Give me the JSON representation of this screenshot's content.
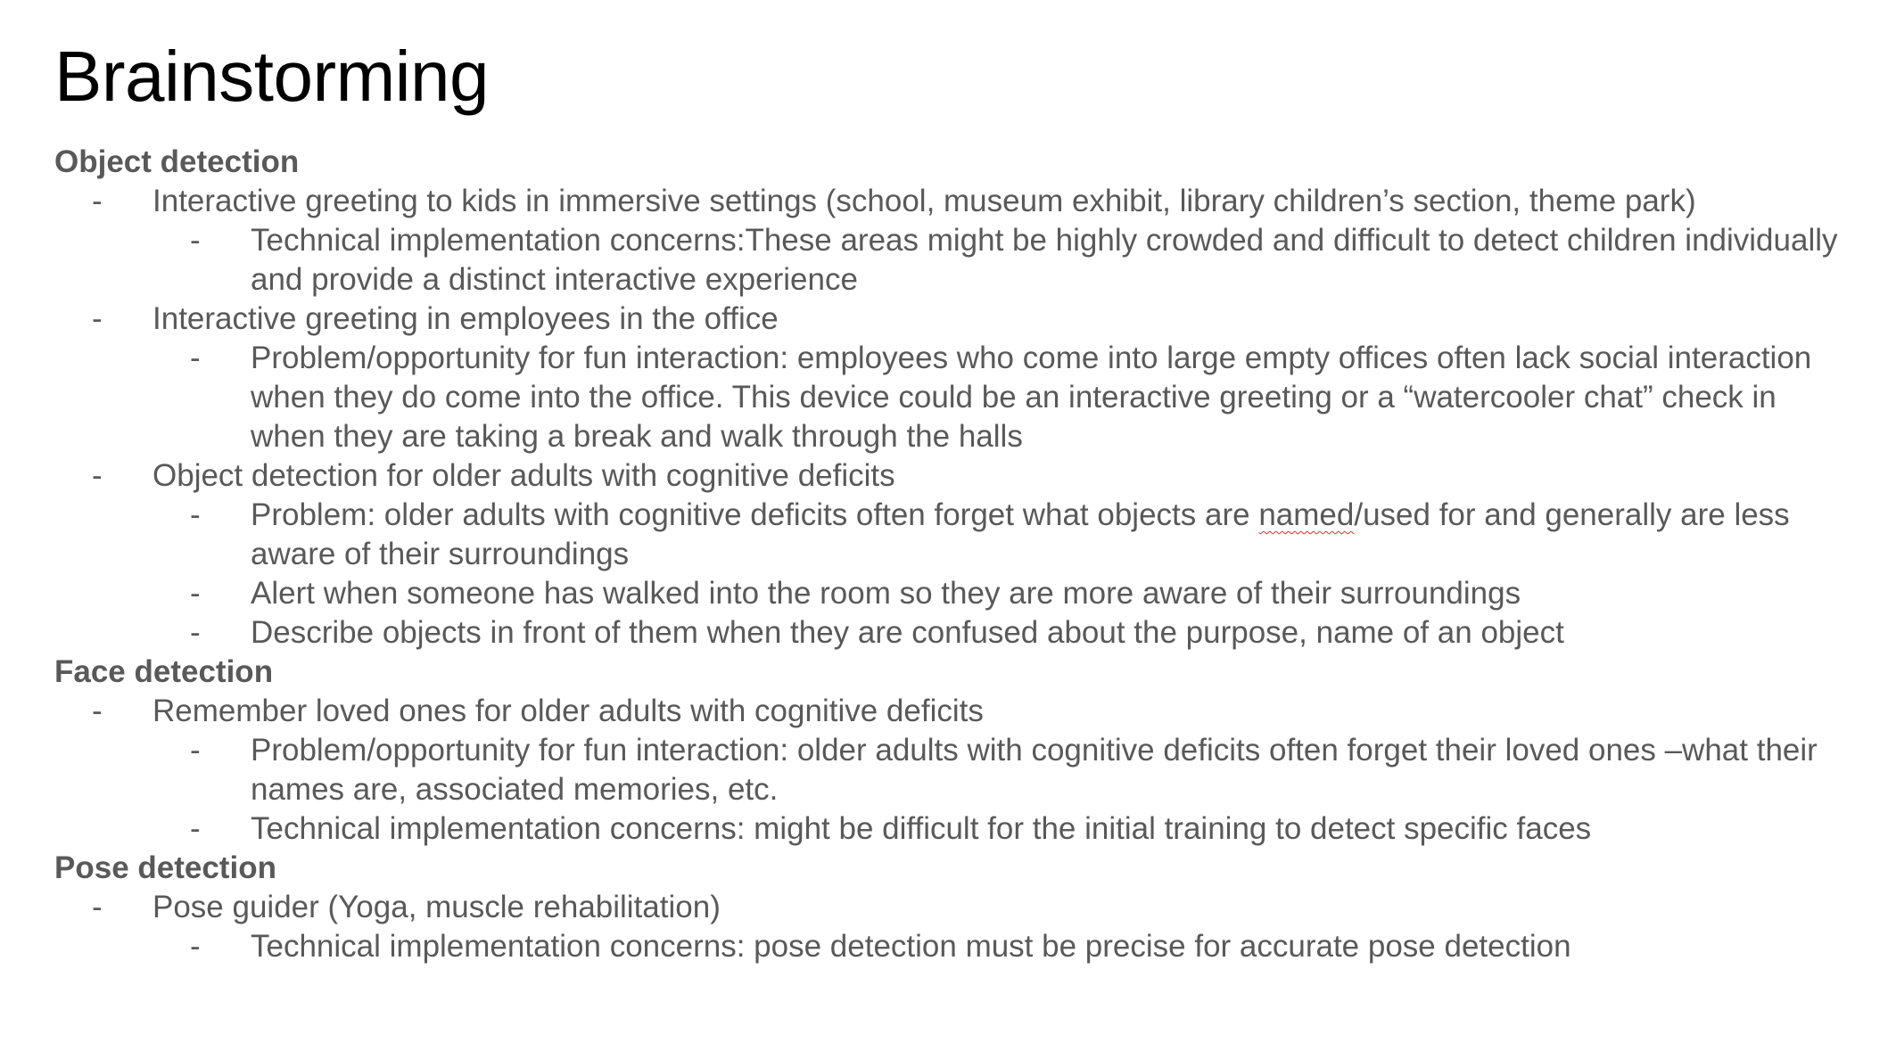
{
  "title": "Brainstorming",
  "sections": [
    {
      "heading": "Object detection",
      "items": [
        {
          "level": 1,
          "text": "Interactive greeting to kids in immersive settings (school, museum exhibit, library children’s section, theme park)"
        },
        {
          "level": 2,
          "text": "Technical implementation concerns:These areas might be highly crowded and difficult to detect children individually and provide a distinct interactive experience"
        },
        {
          "level": 1,
          "text": "Interactive greeting in employees in the office"
        },
        {
          "level": 2,
          "text": "Problem/opportunity for fun interaction: employees who come into large empty offices often lack social interaction when they do come into the office. This device could be an interactive greeting or a “watercooler chat” check in when they are taking a break and walk through the halls"
        },
        {
          "level": 1,
          "text": "Object detection for older adults with cognitive deficits"
        },
        {
          "level": 2,
          "text_before": "Problem: older adults with cognitive deficits often forget what objects are ",
          "flagged": "named",
          "text_after": "/used for and generally are less aware of their surroundings"
        },
        {
          "level": 2,
          "text": "Alert when someone has walked into the room so they are more aware of their surroundings"
        },
        {
          "level": 2,
          "text": "Describe objects in front of them when they are confused about the purpose, name of an object"
        }
      ]
    },
    {
      "heading": "Face detection",
      "items": [
        {
          "level": 1,
          "text": "Remember loved ones for older adults with cognitive deficits"
        },
        {
          "level": 2,
          "text": "Problem/opportunity for fun interaction: older adults with cognitive deficits often forget their loved ones –what their names are, associated memories, etc."
        },
        {
          "level": 2,
          "text": "Technical implementation concerns: might be difficult for the initial training to detect specific faces"
        }
      ]
    },
    {
      "heading": "Pose detection",
      "items": [
        {
          "level": 1,
          "text": "Pose guider (Yoga,  muscle rehabilitation)"
        },
        {
          "level": 2,
          "text": "Technical implementation concerns: pose detection must be precise for accurate pose detection"
        }
      ]
    }
  ],
  "bullet_char": "-",
  "colors": {
    "title": "#000000",
    "body": "#595959",
    "spellcheck": "#dd3333"
  }
}
